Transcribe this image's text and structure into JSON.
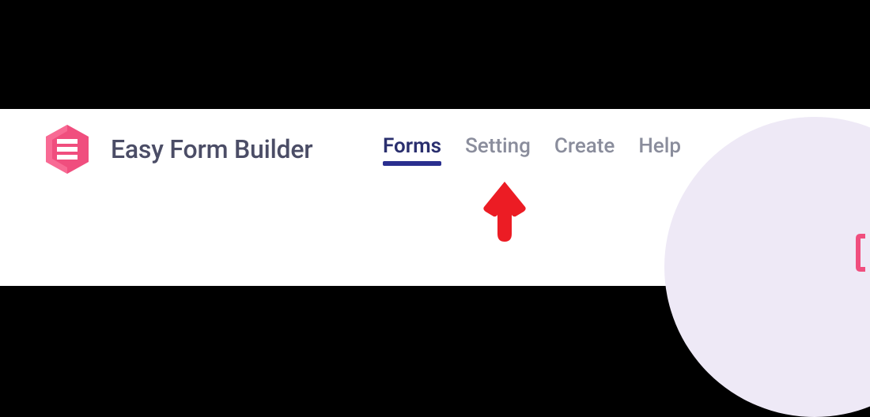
{
  "app": {
    "title": "Easy Form Builder"
  },
  "nav": {
    "items": [
      {
        "label": "Forms",
        "active": true
      },
      {
        "label": "Setting",
        "active": false
      },
      {
        "label": "Create",
        "active": false
      },
      {
        "label": "Help",
        "active": false
      }
    ]
  },
  "annotation": {
    "arrow_points_to": "Setting",
    "arrow_color": "#ec1c24"
  },
  "colors": {
    "brand_pink": "#f04e7e",
    "nav_active": "#2a2f6e",
    "nav_underline": "#2a2f8f",
    "nav_inactive": "#8a8d9c",
    "circle_bg": "#eee9f6"
  }
}
